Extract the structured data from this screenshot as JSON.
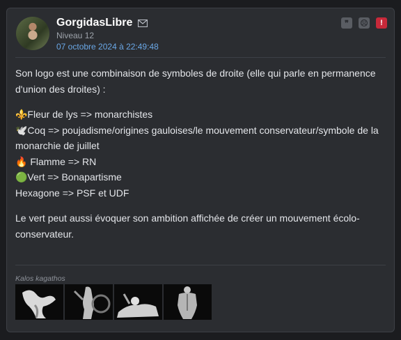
{
  "post": {
    "author": "GorgidasLibre",
    "level": "Niveau 12",
    "date": "07 octobre 2024 à 22:49:48",
    "paragraph1": "Son logo est une combinaison de symboles de droite (elle qui parle en permanence d'union des droites) :",
    "list": [
      "⚜️Fleur de lys => monarchistes",
      "🕊️Coq => poujadisme/origines gauloises/le mouvement conservateur/symbole de la monarchie de juillet",
      "🔥 Flamme => RN",
      "🟢Vert => Bonapartisme",
      "Hexagone => PSF et UDF"
    ],
    "paragraph2": "Le vert peut aussi évoquer son ambition affichée de créer un mouvement écolo-conservateur.",
    "signature_label": "Kalos kagathos"
  },
  "actions": {
    "quote_icon": "quote-icon",
    "sad_icon": "sad-face-icon",
    "alert_icon": "alert-icon"
  },
  "colors": {
    "background": "#1b1c1f",
    "card": "#2b2d31",
    "link": "#6aa7e6",
    "alert": "#c7293a"
  }
}
